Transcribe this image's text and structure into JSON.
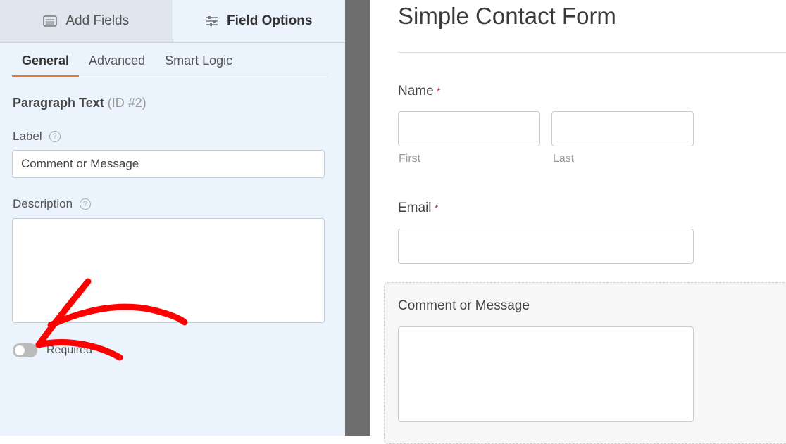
{
  "panel": {
    "tabs": [
      {
        "label": "Add Fields",
        "icon": "list-icon"
      },
      {
        "label": "Field Options",
        "icon": "sliders-icon"
      }
    ],
    "subtabs": [
      "General",
      "Advanced",
      "Smart Logic"
    ],
    "field_type": "Paragraph Text",
    "field_id": "(ID #2)",
    "label_label": "Label",
    "label_value": "Comment or Message",
    "description_label": "Description",
    "description_value": "",
    "required_label": "Required",
    "required_on": false,
    "help_glyph": "?"
  },
  "form": {
    "title": "Simple Contact Form",
    "name_label": "Name",
    "required_mark": "*",
    "first_sub": "First",
    "last_sub": "Last",
    "email_label": "Email",
    "message_label": "Comment or Message"
  },
  "colors": {
    "accent": "#e27730",
    "annotation": "#ff0000",
    "required": "#d63638"
  }
}
